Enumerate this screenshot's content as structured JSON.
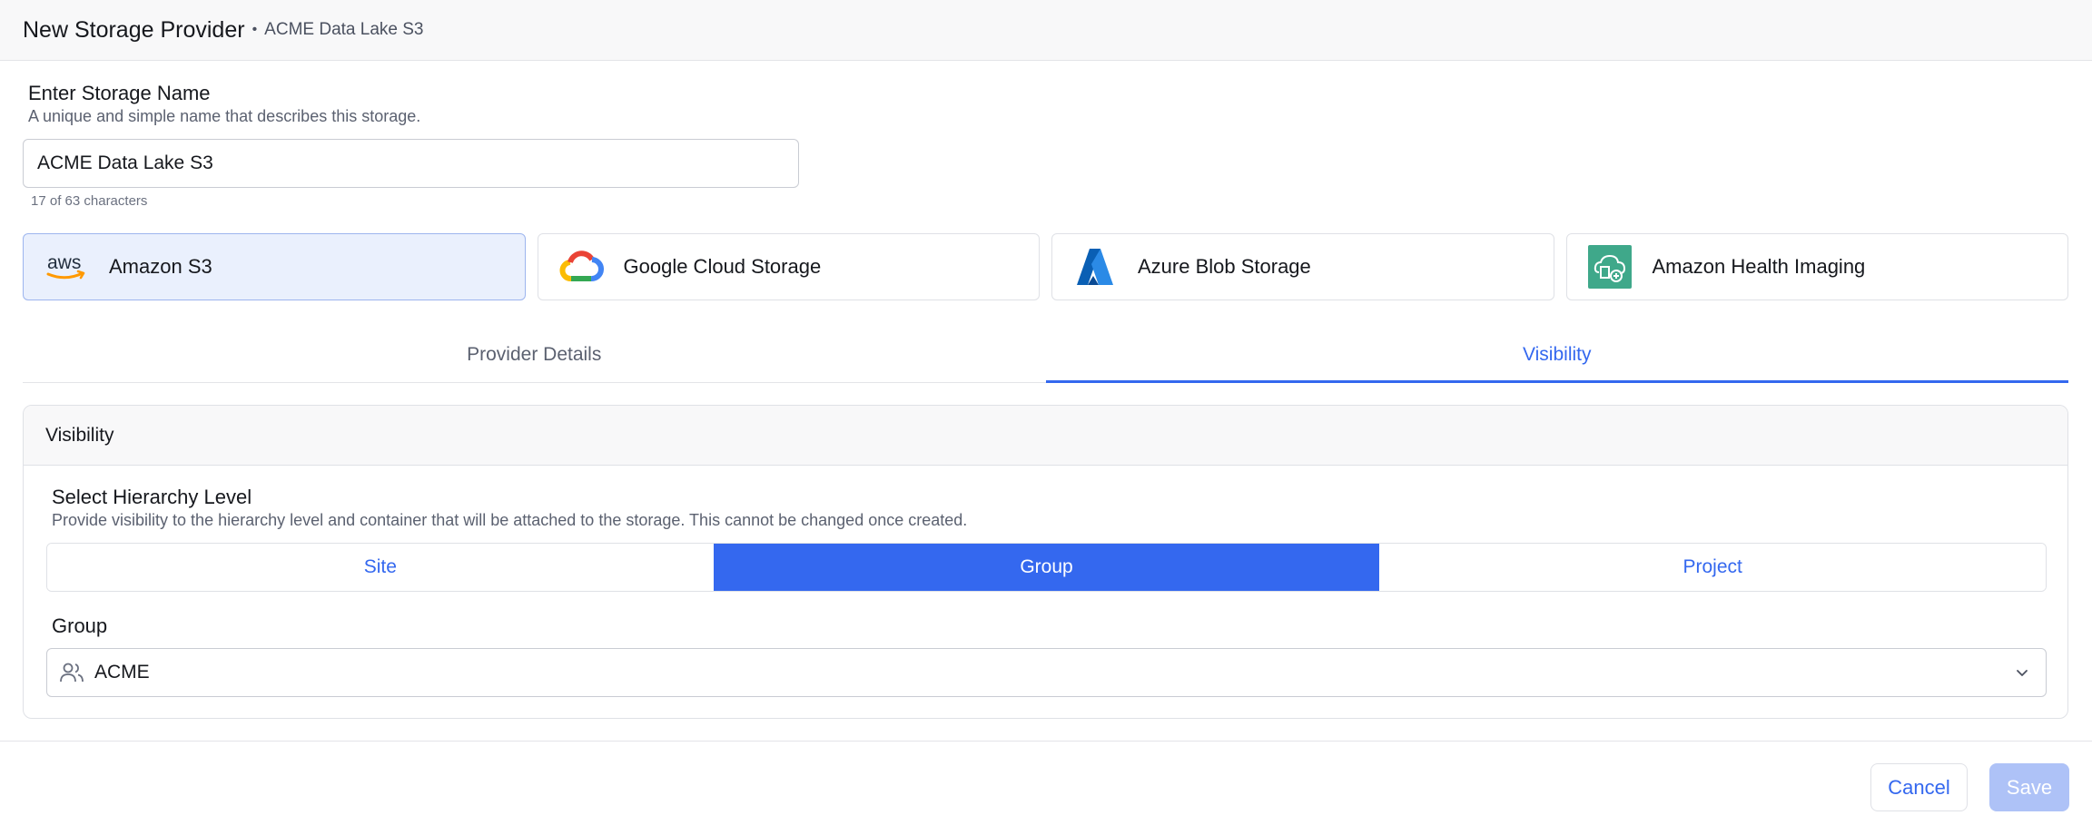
{
  "header": {
    "title": "New Storage Provider",
    "separator": "•",
    "subtitle": "ACME Data Lake S3"
  },
  "storage_name": {
    "label": "Enter Storage Name",
    "description": "A unique and simple name that describes this storage.",
    "value": "ACME Data Lake S3",
    "char_count": "17 of 63 characters"
  },
  "providers": [
    {
      "label": "Amazon S3",
      "icon": "aws-logo-icon",
      "selected": true
    },
    {
      "label": "Google Cloud Storage",
      "icon": "google-cloud-logo-icon",
      "selected": false
    },
    {
      "label": "Azure Blob Storage",
      "icon": "azure-logo-icon",
      "selected": false
    },
    {
      "label": "Amazon Health Imaging",
      "icon": "health-imaging-logo-icon",
      "selected": false
    }
  ],
  "aws_logo_text": "aws",
  "tabs": [
    {
      "label": "Provider Details",
      "active": false
    },
    {
      "label": "Visibility",
      "active": true
    }
  ],
  "visibility": {
    "panel_title": "Visibility",
    "hierarchy_label": "Select Hierarchy Level",
    "hierarchy_description": "Provide visibility to the hierarchy level and container that will be attached to the storage. This cannot be changed once created.",
    "levels": [
      {
        "label": "Site",
        "active": false
      },
      {
        "label": "Group",
        "active": true
      },
      {
        "label": "Project",
        "active": false
      }
    ],
    "group_label": "Group",
    "group_value": "ACME"
  },
  "footer": {
    "cancel_label": "Cancel",
    "save_label": "Save"
  },
  "colors": {
    "accent": "#3468ef",
    "selected_provider_bg": "#eaf0fd",
    "save_disabled": "#aec2f7"
  }
}
